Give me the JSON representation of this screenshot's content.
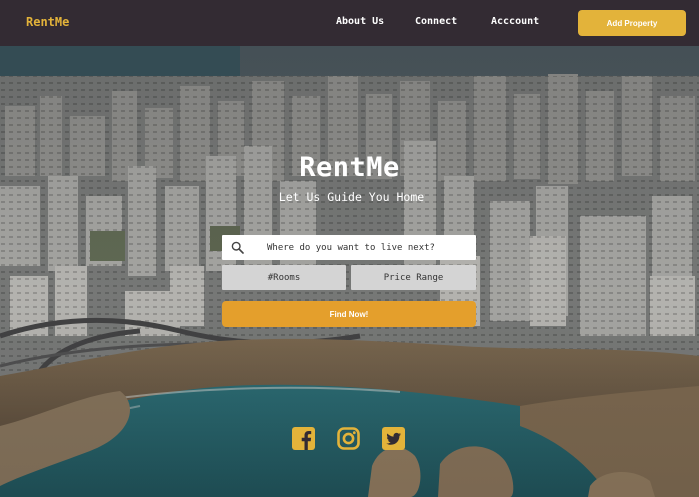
{
  "nav": {
    "brand": "RentMe",
    "links": [
      "About Us",
      "Connect",
      "Acccount"
    ],
    "add_property_label": "Add Property"
  },
  "hero": {
    "title": "RentMe",
    "subtitle": "Let Us Guide You Home"
  },
  "search": {
    "placeholder": "Where do you want to live next?",
    "rooms_label": "#Rooms",
    "price_label": "Price Range",
    "submit_label": "Find Now!"
  },
  "social": {
    "icons": [
      "facebook-icon",
      "instagram-icon",
      "twitter-icon"
    ]
  },
  "colors": {
    "navbar": "#332b33",
    "accent": "#e3b33a",
    "find_button": "#e49f2c",
    "field_gray": "#d4d4d4",
    "sea": "#2f7f86"
  }
}
